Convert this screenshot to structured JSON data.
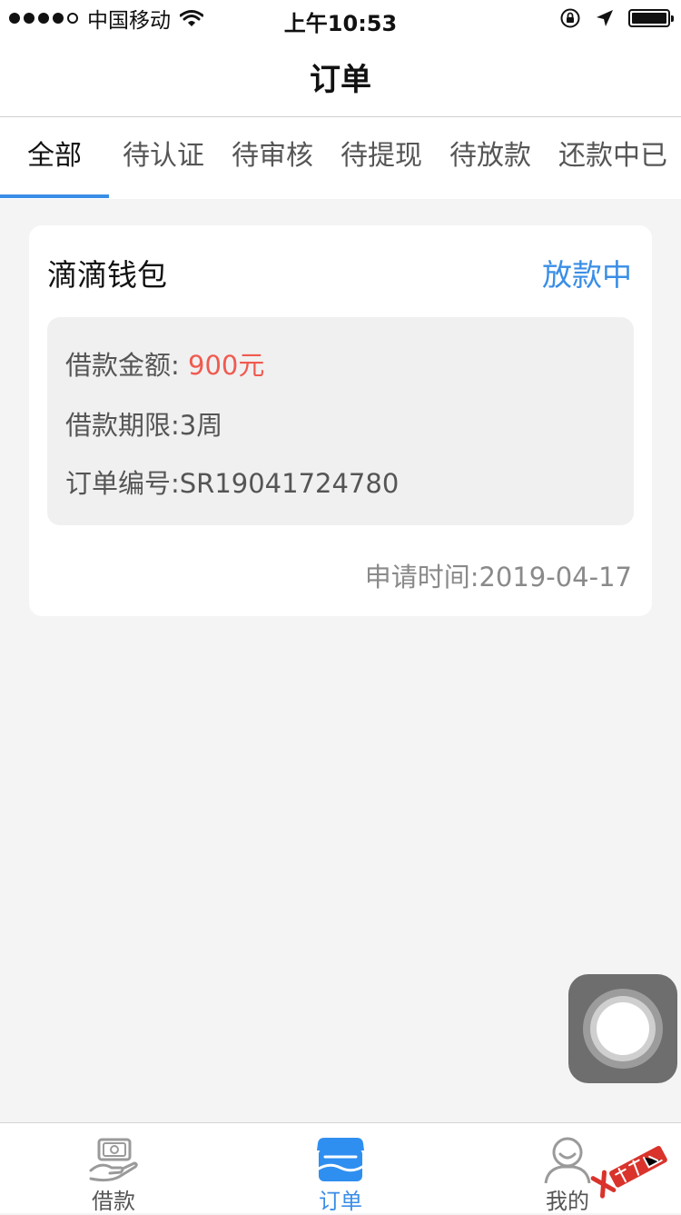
{
  "status_bar": {
    "carrier": "中国移动",
    "time": "上午10:53"
  },
  "nav": {
    "title": "订单"
  },
  "tabs": [
    {
      "label": "全部",
      "active": true
    },
    {
      "label": "待认证",
      "active": false
    },
    {
      "label": "待审核",
      "active": false
    },
    {
      "label": "待提现",
      "active": false
    },
    {
      "label": "待放款",
      "active": false
    },
    {
      "label": "还款中",
      "active": false
    },
    {
      "label": "已",
      "active": false
    }
  ],
  "order": {
    "name": "滴滴钱包",
    "status": "放款中",
    "amount_label": "借款金额:",
    "amount_value": "900元",
    "term": "借款期限:3周",
    "order_no": "订单编号:SR19041724780",
    "apply_time": "申请时间:2019-04-17"
  },
  "tabbar": {
    "items": [
      {
        "label": "借款",
        "icon": "loan-hand-icon"
      },
      {
        "label": "订单",
        "icon": "order-shop-icon"
      },
      {
        "label": "我的",
        "icon": "user-profile-icon"
      }
    ]
  },
  "colors": {
    "accent": "#3a8ee6",
    "amount": "#f05a50",
    "background": "#f4f4f4"
  }
}
